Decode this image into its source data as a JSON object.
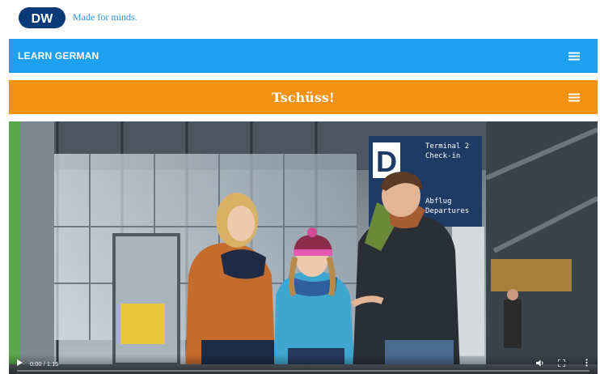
{
  "header": {
    "logo_text": "DW",
    "tagline": "Made for minds."
  },
  "nav": {
    "learn_label": "LEARN GERMAN",
    "menu_icon": "hamburger-icon"
  },
  "lesson": {
    "title": "Tschüss!",
    "menu_icon": "hamburger-icon"
  },
  "video": {
    "sign_letter": "D",
    "sign_line1": "Terminal 2",
    "sign_line2": "Check-in",
    "sign_line3": "Abflug",
    "sign_line4": "Departures",
    "time_display": "0:00 / 1:15",
    "progress": 0,
    "controls": [
      "play-icon",
      "volume-icon",
      "fullscreen-icon",
      "more-options-icon"
    ]
  },
  "colors": {
    "learn_bar": "#1ca0ef",
    "lesson_bar": "#f39111",
    "brand_blue": "#2a8fd6"
  }
}
